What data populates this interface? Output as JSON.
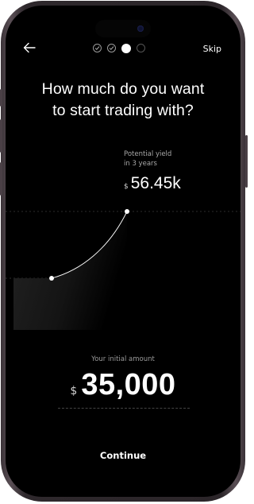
{
  "header": {
    "skip_label": "Skip",
    "back_icon": "arrow-left-icon",
    "steps": [
      {
        "state": "done",
        "icon": "check-icon"
      },
      {
        "state": "done",
        "icon": "check-icon"
      },
      {
        "state": "current"
      },
      {
        "state": "todo"
      }
    ]
  },
  "headline": {
    "line1": "How much do you want",
    "line2": "to start trading with?"
  },
  "yield": {
    "caption_line1": "Potential yield",
    "caption_line2": "in 3 years",
    "currency": "$",
    "value": "56.45k"
  },
  "chart_data": {
    "type": "area",
    "points": [
      {
        "label": "start",
        "value": 35000
      },
      {
        "label": "end",
        "value": 56450
      }
    ]
  },
  "initial": {
    "caption": "Your initial amount",
    "currency": "$",
    "value": "35,000"
  },
  "footer": {
    "continue_label": "Continue"
  },
  "colors": {
    "background": "#000000",
    "text": "#ffffff",
    "muted": "#9a9a9a",
    "frame": "#3b3338"
  }
}
